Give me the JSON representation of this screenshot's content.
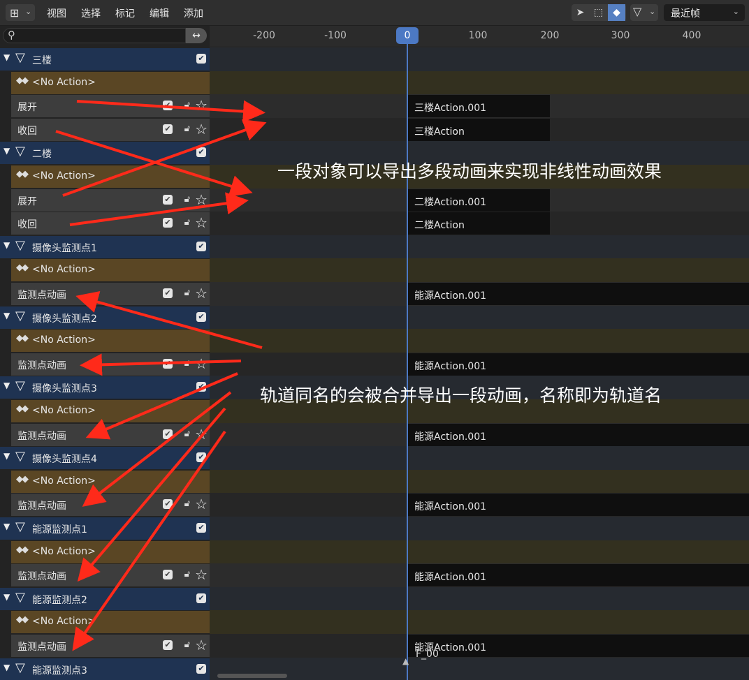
{
  "header": {
    "menus": [
      "视图",
      "选择",
      "标记",
      "编辑",
      "添加"
    ],
    "editor_type_icon": "nla-editor-icon",
    "tools": [
      "select-arrow-icon",
      "box-select-icon",
      "keyframe-icon"
    ],
    "filter_icon": "filter-icon",
    "frame_select": "最近帧"
  },
  "search": {
    "placeholder": ""
  },
  "ruler": {
    "labels": [
      "-200",
      "-100",
      "100",
      "200",
      "300",
      "400"
    ],
    "current_frame": "0"
  },
  "tracks": [
    {
      "type": "object",
      "label": "三楼"
    },
    {
      "type": "noaction",
      "label": "<No Action>"
    },
    {
      "type": "track",
      "label": "展开",
      "strip": "三楼Action.001"
    },
    {
      "type": "track",
      "label": "收回",
      "strip": "三楼Action"
    },
    {
      "type": "object",
      "label": "二楼"
    },
    {
      "type": "noaction",
      "label": "<No Action>"
    },
    {
      "type": "track",
      "label": "展开",
      "strip": "二楼Action.001"
    },
    {
      "type": "track",
      "label": "收回",
      "strip": "二楼Action"
    },
    {
      "type": "object",
      "label": "摄像头监测点1"
    },
    {
      "type": "noaction",
      "label": "<No Action>"
    },
    {
      "type": "track",
      "label": "监测点动画",
      "strip": "能源Action.001"
    },
    {
      "type": "object",
      "label": "摄像头监测点2"
    },
    {
      "type": "noaction",
      "label": "<No Action>"
    },
    {
      "type": "track",
      "label": "监测点动画",
      "strip": "能源Action.001"
    },
    {
      "type": "object",
      "label": "摄像头监测点3"
    },
    {
      "type": "noaction",
      "label": "<No Action>"
    },
    {
      "type": "track",
      "label": "监测点动画",
      "strip": "能源Action.001"
    },
    {
      "type": "object",
      "label": "摄像头监测点4"
    },
    {
      "type": "noaction",
      "label": "<No Action>"
    },
    {
      "type": "track",
      "label": "监测点动画",
      "strip": "能源Action.001"
    },
    {
      "type": "object",
      "label": "能源监测点1"
    },
    {
      "type": "noaction",
      "label": "<No Action>"
    },
    {
      "type": "track",
      "label": "监测点动画",
      "strip": "能源Action.001"
    },
    {
      "type": "object",
      "label": "能源监测点2"
    },
    {
      "type": "noaction",
      "label": "<No Action>"
    },
    {
      "type": "track",
      "label": "监测点动画",
      "strip": "能源Action.001"
    },
    {
      "type": "object",
      "label": "能源监测点3"
    }
  ],
  "annotations": {
    "top": "一段对象可以导出多段动画来实现非线性动画效果",
    "bottom": "轨道同名的会被合并导出一段动画，名称即为轨道名"
  },
  "frame_marker": "F_00",
  "colors": {
    "accent": "#4c79c4",
    "annotation_arrow": "#ff2a1a",
    "object_row": "#1f3352",
    "no_action_row": "#5a4624",
    "track_row": "#3d3d3d",
    "strip": "#0f0f0f"
  }
}
